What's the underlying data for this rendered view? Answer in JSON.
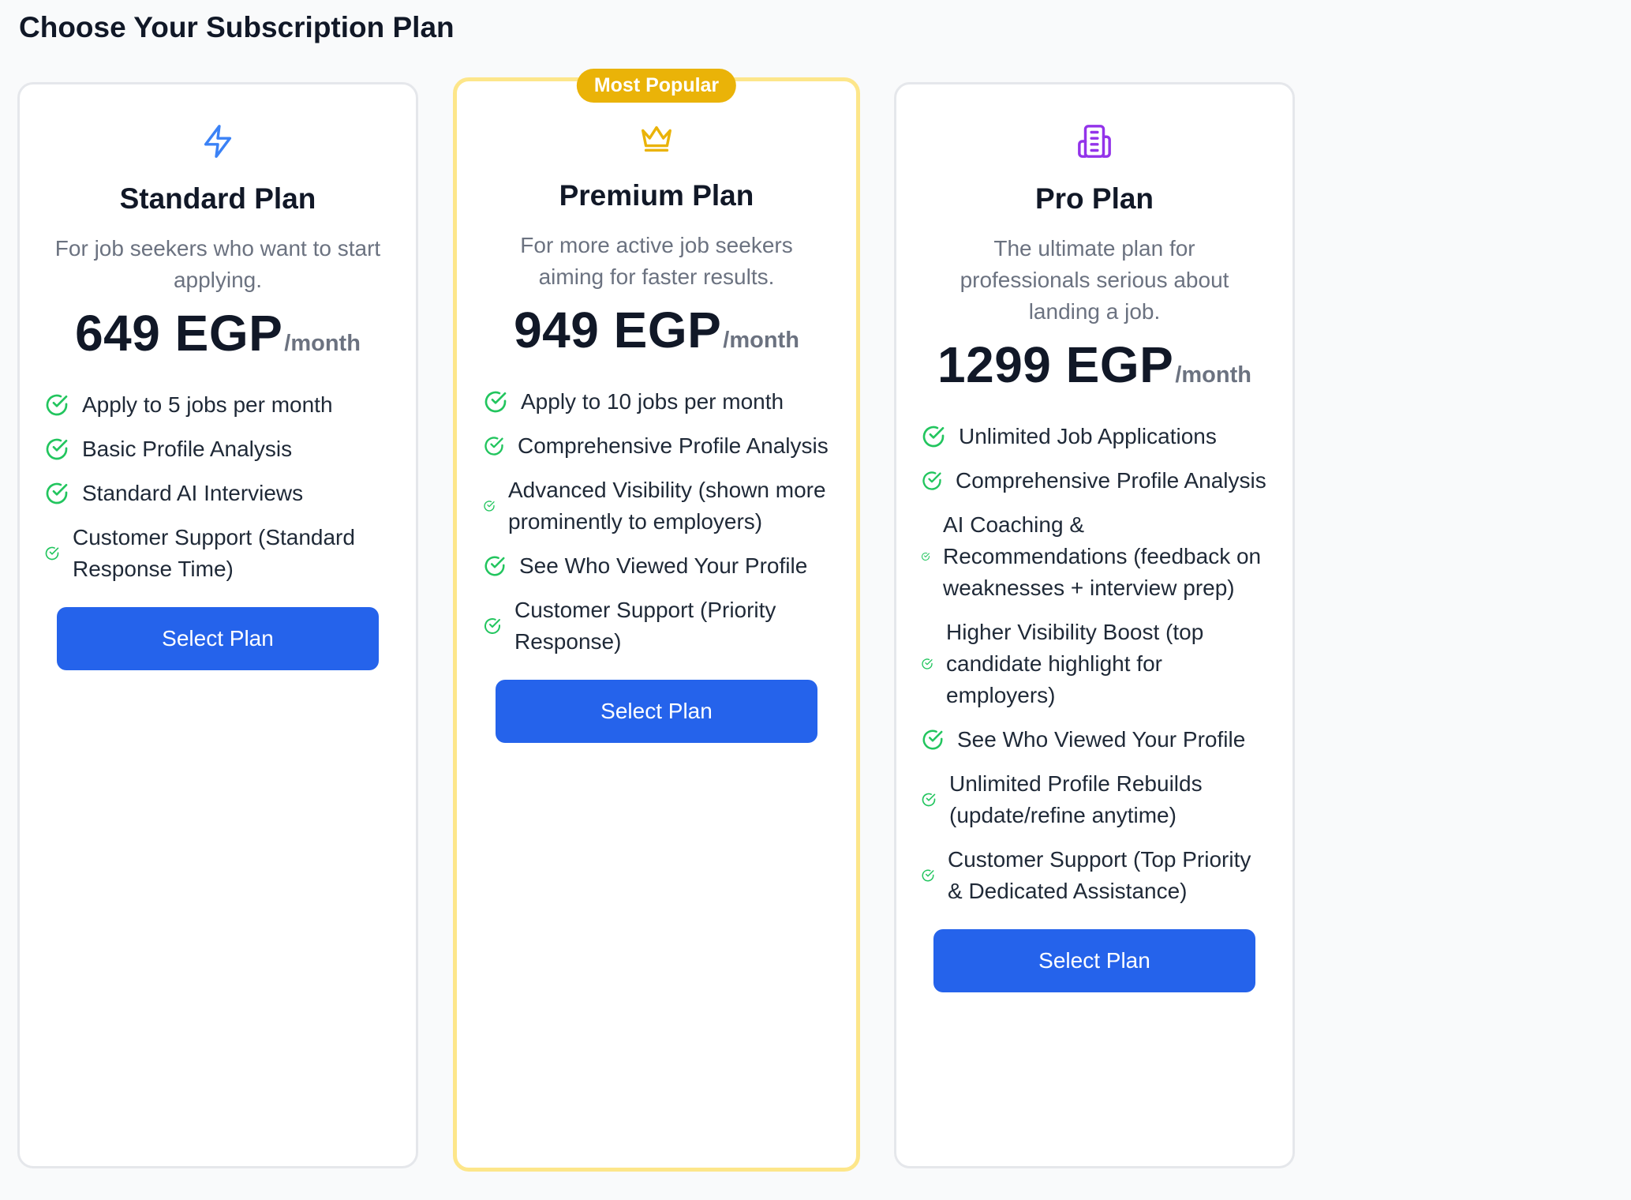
{
  "page": {
    "title": "Choose Your Subscription Plan"
  },
  "colors": {
    "accent_blue": "#2563eb",
    "check_green": "#22c55e",
    "popular_border": "#fde68a",
    "popular_badge": "#eab308",
    "standard_icon": "#3b82f6",
    "premium_icon": "#eab308",
    "pro_icon": "#9333ea"
  },
  "plans": [
    {
      "icon": "lightning-icon",
      "name": "Standard Plan",
      "description": "For job seekers who want to start applying.",
      "price": "649 EGP",
      "period": "/month",
      "features": [
        "Apply to 5 jobs per month",
        "Basic Profile Analysis",
        "Standard AI Interviews",
        "Customer Support (Standard Response Time)"
      ],
      "button": "Select Plan"
    },
    {
      "icon": "crown-icon",
      "badge": "Most Popular",
      "name": "Premium Plan",
      "description": "For more active job seekers aiming for faster results.",
      "price": "949 EGP",
      "period": "/month",
      "features": [
        "Apply to 10 jobs per month",
        "Comprehensive Profile Analysis",
        "Advanced Visibility (shown more prominently to employers)",
        "See Who Viewed Your Profile",
        "Customer Support (Priority Response)"
      ],
      "button": "Select Plan"
    },
    {
      "icon": "building-icon",
      "name": "Pro Plan",
      "description": "The ultimate plan for professionals serious about landing a job.",
      "price": "1299 EGP",
      "period": "/month",
      "features": [
        "Unlimited Job Applications",
        "Comprehensive Profile Analysis",
        "AI Coaching & Recommendations (feedback on weaknesses + interview prep)",
        "Higher Visibility Boost (top candidate highlight for employers)",
        "See Who Viewed Your Profile",
        "Unlimited Profile Rebuilds (update/refine anytime)",
        "Customer Support (Top Priority & Dedicated Assistance)"
      ],
      "button": "Select Plan"
    }
  ]
}
